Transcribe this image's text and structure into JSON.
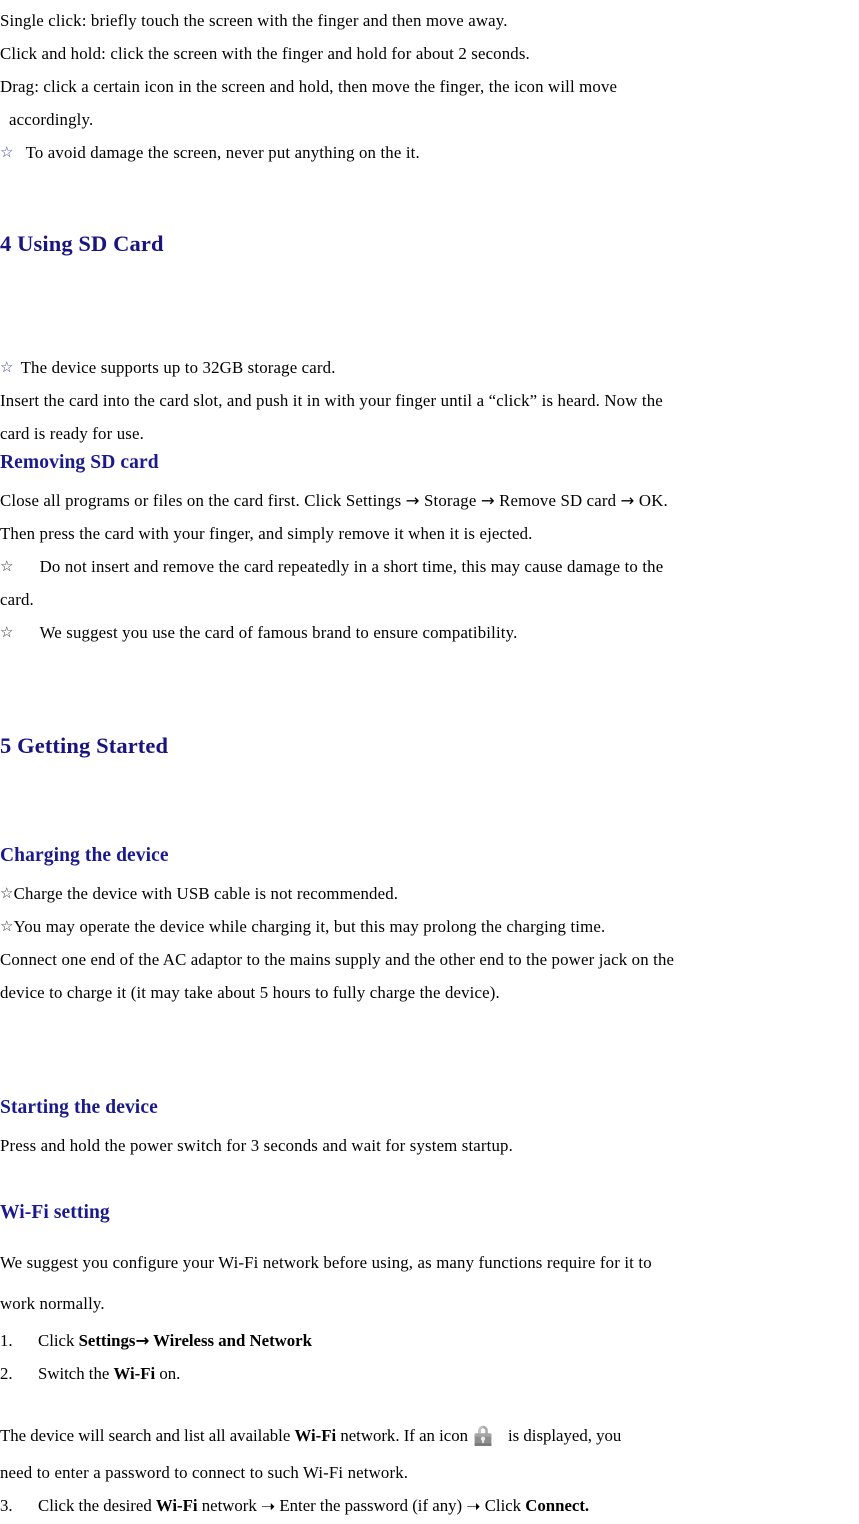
{
  "document": {
    "page_background": "#ffffff",
    "body_text_color": "#000000",
    "heading_color": "#191480",
    "star_blue_color": "#3b3b9e",
    "lock_icon_color": "#9a9a9a"
  },
  "touch_instructions": {
    "single_click": "Single click: briefly touch the screen with the finger and then move away.",
    "click_and_hold": "Click and hold: click the screen with the finger and hold for about 2 seconds.",
    "drag_line1": "Drag: click a certain icon in the screen and hold, then move the finger, the icon will move",
    "drag_line2": "accordingly.",
    "warning_star": "☆",
    "warning_text": "To avoid damage the screen, never put anything on the it."
  },
  "section_sd": {
    "heading": "4 Using SD Card",
    "note_star": "☆",
    "note_text": "The device supports up to 32GB storage card.",
    "insert_line1": "Insert the card into the card slot, and push it in with your finger until a “click” is heard. Now the",
    "insert_line2": "card is ready for use.",
    "removing_heading": "Removing SD card",
    "removing_line1_a": "Close all programs or files on the card first. Click Settings ",
    "removing_arrow": "→",
    "removing_line1_b": " Storage ",
    "removing_line1_c": " Remove SD card ",
    "removing_line1_d": " OK.",
    "removing_line2": "Then press the card with your finger, and simply remove it when it is ejected.",
    "caution1_star": "☆",
    "caution1_line1": "Do not insert and remove the card repeatedly in a short time, this may cause damage to the",
    "caution1_line2": "card.",
    "caution2_star": "☆",
    "caution2_text": "We suggest you use the card of famous brand to ensure compatibility."
  },
  "section_getting_started": {
    "heading": "5 Getting Started",
    "charging_heading": "Charging the device",
    "charging_star1": "☆",
    "charging_note1": "Charge the device with USB cable is not recommended.",
    "charging_star2": "☆",
    "charging_note2": "You may operate the device while charging it, but this may prolong the charging time.",
    "charging_line1": "Connect one end of the AC adaptor to the mains supply and the other end to the power jack on the",
    "charging_line2": "device to charge it (it may take about 5 hours to fully charge the device).",
    "starting_heading": "Starting the device",
    "starting_text": "Press and hold the power switch for 3 seconds and wait for system startup.",
    "wifi_heading": "Wi-Fi setting",
    "wifi_intro_line1": "We suggest you configure your Wi-Fi network before using, as many functions require for it to",
    "wifi_intro_line2": "work normally.",
    "steps": [
      {
        "number": "1.",
        "text_before": "Click ",
        "bold1": "Settings",
        "arrow": "→",
        "bold2": " Wireless and Network",
        "text_after": ""
      },
      {
        "number": "2.",
        "text_before": "Switch the ",
        "bold1": "Wi-Fi",
        "text_after": " on."
      }
    ],
    "icon_para_a": "The device will search and list all available ",
    "icon_para_bold": "Wi-Fi",
    "icon_para_b": " network. If an icon",
    "icon_name": "lock-icon",
    "icon_para_c": "is displayed, you",
    "icon_para_line2": "need to enter a password to connect to such Wi-Fi network.",
    "step3": {
      "number": "3.",
      "part_a": "Click the desired ",
      "bold_a": "Wi-Fi",
      "part_b": " network ",
      "arrow1": "➝",
      "part_c": " Enter the password (if any) ",
      "arrow2": "➝",
      "part_d": " Click ",
      "bold_b": "Connect."
    }
  }
}
